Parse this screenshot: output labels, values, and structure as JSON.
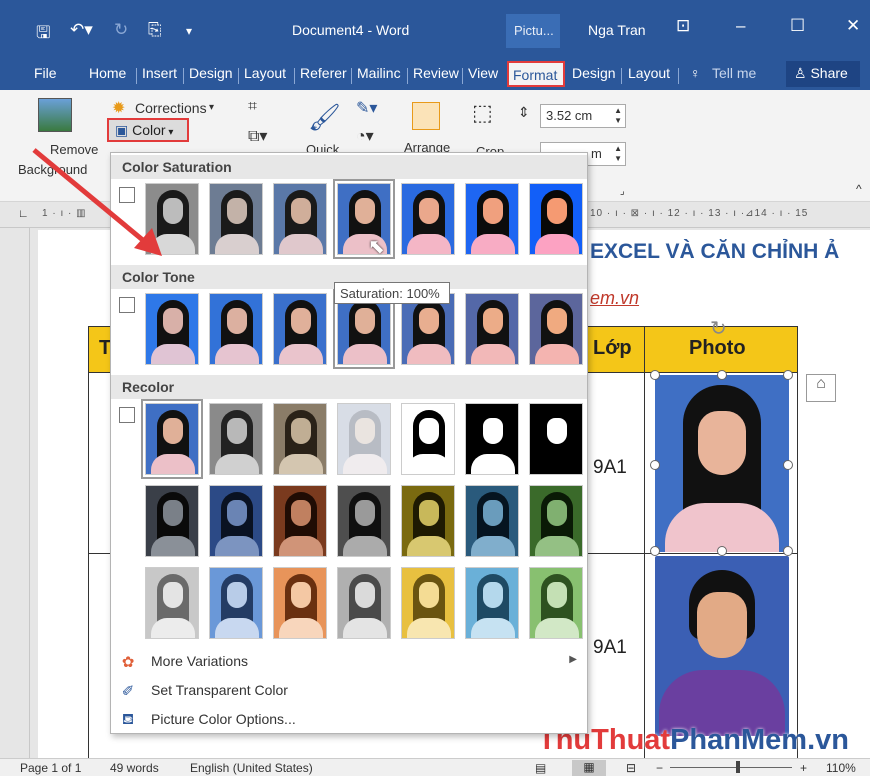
{
  "titlebar": {
    "save_icon": "save-icon",
    "undo_icon": "undo-icon",
    "redo_icon": "redo-icon",
    "touch_icon": "touch-mode-icon",
    "customize_icon": "customize-qa-icon",
    "doc_title": "Document4 - Word",
    "picture_tools": "Pictu...",
    "user": "Nga Tran",
    "ribbon_display": "ribbon-display-icon",
    "minimize": "–",
    "maximize": "☐",
    "close": "✕"
  },
  "tabs": {
    "file": "File",
    "home": "Home",
    "insert": "Insert",
    "design": "Design",
    "layout": "Layout",
    "references": "Referer",
    "mailings": "Mailinc",
    "review": "Review",
    "view": "View",
    "format": "Format",
    "design2": "Design",
    "layout2": "Layout",
    "tellme": "Tell me",
    "share": "Share"
  },
  "ribbon": {
    "remove_bg_line1": "Remove",
    "remove_bg_line2": "Background",
    "corrections": "Corrections",
    "color": "Color",
    "quick": "Quick",
    "arrange": "Arrange",
    "crop": "Crop",
    "height": "3.52 cm",
    "width": "m"
  },
  "document": {
    "heading": "EXCEL VÀ CĂN CHỈNH Ả",
    "link": "em.vn",
    "th_t": "T",
    "th_lop": "Lớp",
    "th_photo": "Photo",
    "row1_class": "9A1",
    "row2_class": "9A1"
  },
  "dropdown": {
    "color_saturation": "Color Saturation",
    "color_tone": "Color Tone",
    "recolor": "Recolor",
    "tooltip": "Saturation: 100%",
    "more_variations": "More Variations",
    "set_transparent": "Set Transparent Color",
    "picture_color_options": "Picture Color Options...",
    "more_variations_underline": "M",
    "set_transparent_underline": "S",
    "picture_color_options_underline": "C"
  },
  "statusbar": {
    "page": "Page 1 of 1",
    "words": "49 words",
    "language": "English (United States)",
    "zoom": "110%",
    "zoom_minus": "−",
    "zoom_plus": "+"
  },
  "watermark": {
    "part1": "Thu",
    "part2": "Thuat",
    "part3": "PhanMem",
    "part4": ".vn"
  },
  "colors": {
    "word_blue": "#2b579a",
    "highlight_red": "#e23b3b",
    "table_header": "#f4c618"
  },
  "thumbnails": {
    "saturation": [
      {
        "bg": "#8c8c8c",
        "hair": "#1a1a1a",
        "face": "#bcbcbc",
        "body": "#d8d8d8"
      },
      {
        "bg": "#6d7c93",
        "hair": "#1a1a1a",
        "face": "#c3b2a8",
        "body": "#d9cfcf"
      },
      {
        "bg": "#5a78a8",
        "hair": "#1a1a1a",
        "face": "#d0ae9a",
        "body": "#e0c8cc"
      },
      {
        "bg": "#3f6fc4",
        "hair": "#111",
        "face": "#e0b098",
        "body": "#ecc0c8"
      },
      {
        "bg": "#2a6ae0",
        "hair": "#111",
        "face": "#eaa88c",
        "body": "#f4b6c6"
      },
      {
        "bg": "#1e66f2",
        "hair": "#0c0c0c",
        "face": "#f0a07e",
        "body": "#f8acc4"
      },
      {
        "bg": "#125ff8",
        "hair": "#080808",
        "face": "#f59a72",
        "body": "#fca2c2"
      }
    ],
    "tone": [
      {
        "bg": "#2e78e8",
        "hair": "#111",
        "face": "#d8b0a8",
        "body": "#e0c4d4"
      },
      {
        "bg": "#3272d8",
        "hair": "#111",
        "face": "#dcb0a0",
        "body": "#e6c4d0"
      },
      {
        "bg": "#3a70cc",
        "hair": "#111",
        "face": "#e0b09a",
        "body": "#eac4cc"
      },
      {
        "bg": "#3f6fc4",
        "hair": "#111",
        "face": "#e0b098",
        "body": "#ecc0c8"
      },
      {
        "bg": "#4a6cb6",
        "hair": "#111",
        "face": "#e8ae90",
        "body": "#f0bcc0"
      },
      {
        "bg": "#5468a8",
        "hair": "#111",
        "face": "#ecac88",
        "body": "#f2b8b8"
      },
      {
        "bg": "#5c669c",
        "hair": "#111",
        "face": "#f0aa80",
        "body": "#f4b4b0"
      }
    ],
    "recolor1": [
      {
        "bg": "#3f6fc4",
        "hair": "#111",
        "face": "#e0b098",
        "body": "#ecc0c8"
      },
      {
        "bg": "#8a8a8a",
        "hair": "#222",
        "face": "#b8b8b8",
        "body": "#d0d0d0"
      },
      {
        "bg": "#8a7c68",
        "hair": "#2a2218",
        "face": "#c0ae94",
        "body": "#d4c6b0"
      },
      {
        "bg": "#d8dde6",
        "hair": "#b8bcc4",
        "face": "#eae4e0",
        "body": "#f0ecee"
      },
      {
        "bg": "#ffffff",
        "hair": "#000",
        "face": "#ffffff",
        "body": "#ffffff"
      },
      {
        "bg": "#000000",
        "hair": "#000",
        "face": "#ffffff",
        "body": "#ffffff"
      },
      {
        "bg": "#000000",
        "hair": "#000",
        "face": "#ffffff",
        "body": "#000000"
      }
    ],
    "recolor2": [
      {
        "bg": "#3a3f48",
        "hair": "#0a0a0a",
        "face": "#7a8088",
        "body": "#8a9098"
      },
      {
        "bg": "#2c4a86",
        "hair": "#0a1222",
        "face": "#6a84b4",
        "body": "#7c94c0"
      },
      {
        "bg": "#7a3a1e",
        "hair": "#200c04",
        "face": "#c08060",
        "body": "#d09478"
      },
      {
        "bg": "#4e4e4e",
        "hair": "#101010",
        "face": "#9a9a9a",
        "body": "#ababab"
      },
      {
        "bg": "#7a6a10",
        "hair": "#1e1a02",
        "face": "#c8b85a",
        "body": "#d8c870"
      },
      {
        "bg": "#2a5a7c",
        "hair": "#061420",
        "face": "#6a9cbc",
        "body": "#80aecc"
      },
      {
        "bg": "#3a6a2a",
        "hair": "#0a1a06",
        "face": "#80b070",
        "body": "#94c084"
      }
    ],
    "recolor3": [
      {
        "bg": "#c8c8c8",
        "hair": "#6a6a6a",
        "face": "#e4e4e4",
        "body": "#ececec"
      },
      {
        "bg": "#6a98d8",
        "hair": "#243c64",
        "face": "#b8cce8",
        "body": "#c8d8f0"
      },
      {
        "bg": "#e8945a",
        "hair": "#6a3010",
        "face": "#f4c8a4",
        "body": "#f8d6bc"
      },
      {
        "bg": "#b0b0b0",
        "hair": "#4a4a4a",
        "face": "#dadada",
        "body": "#e4e4e4"
      },
      {
        "bg": "#e8c040",
        "hair": "#6a5410",
        "face": "#f4dc94",
        "body": "#f8e6b0"
      },
      {
        "bg": "#6ab0d8",
        "hair": "#1e4a64",
        "face": "#b4d8ec",
        "body": "#c6e2f2"
      },
      {
        "bg": "#88c070",
        "hair": "#2e5220",
        "face": "#c4e0b4",
        "body": "#d2e8c6"
      }
    ]
  }
}
